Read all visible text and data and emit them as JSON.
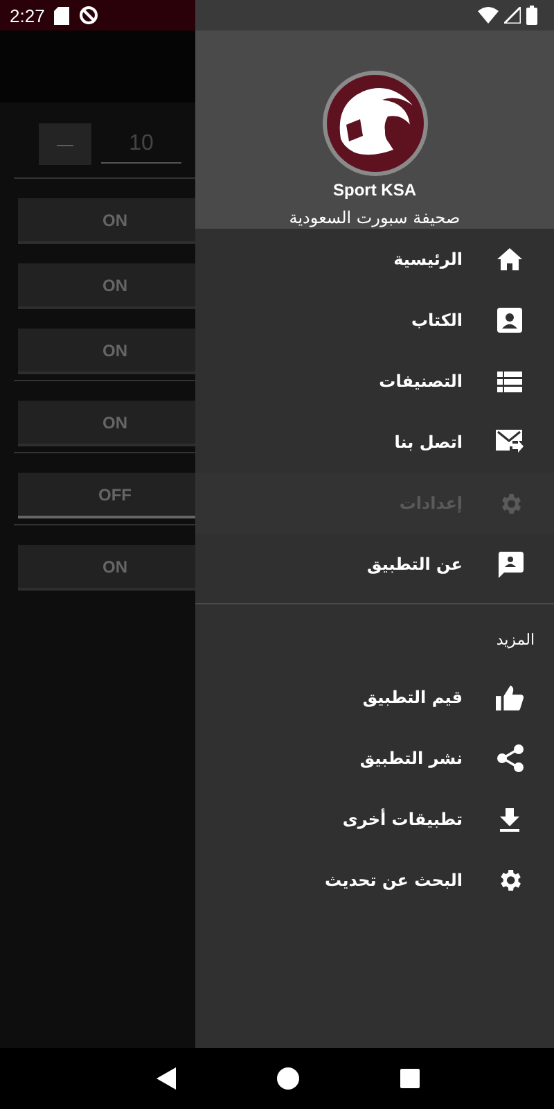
{
  "status_bar": {
    "time": "2:27"
  },
  "background": {
    "stepper": {
      "minus": "—",
      "value": "10"
    },
    "toggles": [
      {
        "label": "ON",
        "on": true
      },
      {
        "label": "ON",
        "on": true
      },
      {
        "label": "ON",
        "on": true
      },
      {
        "label": "ON",
        "on": true
      },
      {
        "label": "OFF",
        "on": false
      },
      {
        "label": "ON",
        "on": true
      }
    ]
  },
  "drawer": {
    "header": {
      "app_name": "Sport KSA",
      "subtitle": "صحيفة سبورت السعودية"
    },
    "items": [
      {
        "label": "الرئيسية",
        "disabled": false
      },
      {
        "label": "الكتاب",
        "disabled": false
      },
      {
        "label": "التصنيفات",
        "disabled": false
      },
      {
        "label": "اتصل بنا",
        "disabled": false
      },
      {
        "label": "إعدادات",
        "disabled": true
      },
      {
        "label": "عن التطبيق",
        "disabled": false
      }
    ],
    "section_title": "المزيد",
    "more_items": [
      {
        "label": "قيم التطبيق"
      },
      {
        "label": "نشر التطبيق"
      },
      {
        "label": "تطبيقات أخرى"
      },
      {
        "label": "البحث عن تحديث"
      }
    ]
  }
}
